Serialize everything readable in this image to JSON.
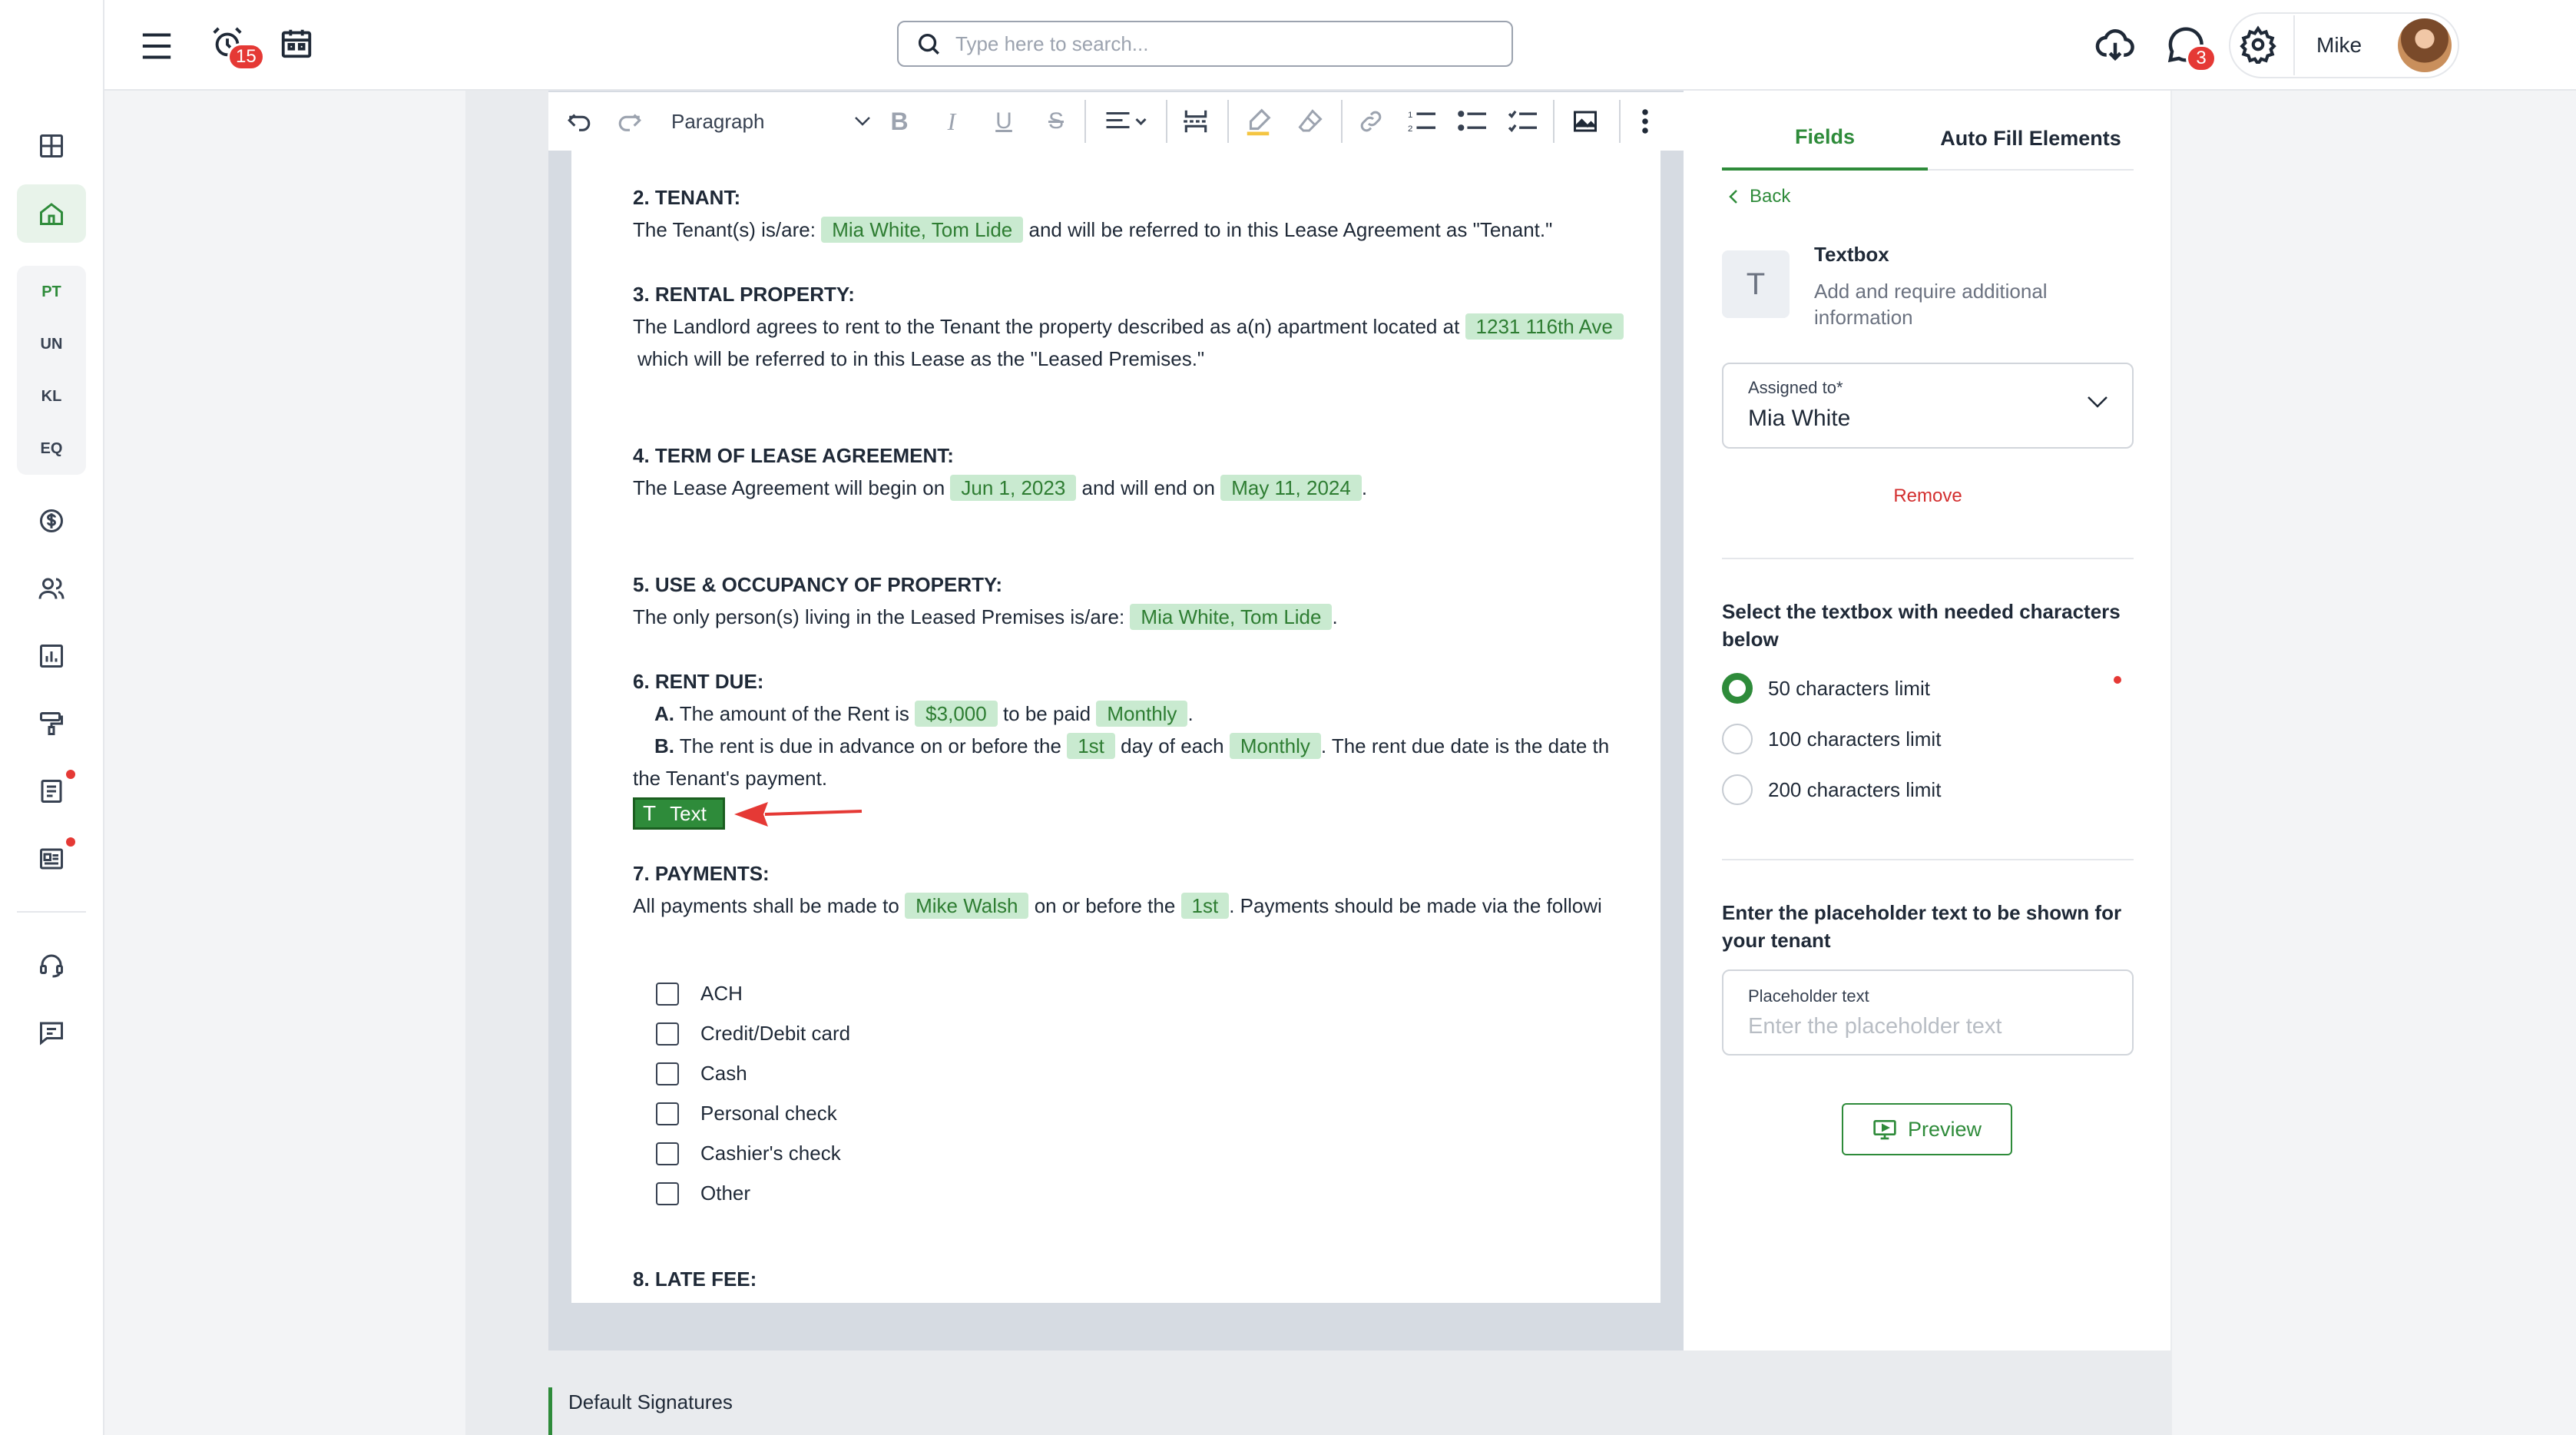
{
  "sidebar": {
    "items": [
      {
        "icon": "dashboard-grid-icon"
      },
      {
        "icon": "home-icon",
        "active": true
      },
      {
        "label": "PT"
      },
      {
        "label": "UN"
      },
      {
        "label": "KL"
      },
      {
        "label": "EQ"
      },
      {
        "icon": "dollar-circle-icon"
      },
      {
        "icon": "people-icon"
      },
      {
        "icon": "bar-chart-icon"
      },
      {
        "icon": "paint-roller-icon"
      },
      {
        "icon": "document-list-icon"
      },
      {
        "icon": "newspaper-icon"
      },
      {
        "icon": "headset-icon"
      },
      {
        "icon": "chat-square-icon"
      }
    ]
  },
  "header": {
    "alarm_badge": "15",
    "search_placeholder": "Type here to search...",
    "messages_badge": "3",
    "user_name": "Mike"
  },
  "toolbar": {
    "paragraph_label": "Paragraph"
  },
  "document": {
    "s2_title": "2. TENANT:",
    "s2_pre": "The Tenant(s) is/are:",
    "s2_tag": "Mia White, Tom Lide",
    "s2_post": "and will be referred to in this Lease Agreement as \"Tenant.\"",
    "s3_title": "3. RENTAL PROPERTY:",
    "s3_pre": "The Landlord agrees to rent to the Tenant the property described as a(n) apartment located at",
    "s3_tag": "1231 116th Ave",
    "s3_line2": "which will be referred to in this Lease as the \"Leased Premises.\"",
    "s4_title": "4. TERM OF LEASE AGREEMENT:",
    "s4_pre": "The Lease Agreement will begin on",
    "s4_tag1": "Jun 1, 2023",
    "s4_mid": "and will end on",
    "s4_tag2": "May 11, 2024",
    "s4_post": ".",
    "s5_title": "5. USE & OCCUPANCY OF PROPERTY:",
    "s5_pre": "The only person(s) living in the Leased Premises is/are:",
    "s5_tag": "Mia White, Tom Lide",
    "s5_post": ".",
    "s6_title": "6. RENT DUE:",
    "s6_a_label": "A.",
    "s6_a_pre": "The amount of the Rent is",
    "s6_a_tag1": "$3,000",
    "s6_a_mid": "to be paid",
    "s6_a_tag2": "Monthly",
    "s6_a_post": ".",
    "s6_b_label": "B.",
    "s6_b_pre": "The rent is due in advance on or before the",
    "s6_b_tag1": "1st",
    "s6_b_mid": "day of each",
    "s6_b_tag2": "Monthly",
    "s6_b_post": ". The rent due date is the date th",
    "s6_line3": "the Tenant's payment.",
    "text_chip_label": "Text",
    "s7_title": "7. PAYMENTS:",
    "s7_pre": "All payments shall be made to",
    "s7_tag1": "Mike Walsh",
    "s7_mid": "on or before the",
    "s7_tag2": "1st",
    "s7_post": ". Payments should be made via the followi",
    "payment_methods": [
      "ACH",
      "Credit/Debit card",
      "Cash",
      "Personal check",
      "Cashier's check",
      "Other"
    ],
    "s8_title": "8. LATE FEE:"
  },
  "panel": {
    "tab_fields": "Fields",
    "tab_autofill": "Auto Fill Elements",
    "back_label": "Back",
    "textbox_icon_letter": "T",
    "textbox_title": "Textbox",
    "textbox_desc": "Add and require additional information",
    "assigned_label": "Assigned to*",
    "assigned_value": "Mia White",
    "remove_label": "Remove",
    "limit_title": "Select the textbox with needed characters below",
    "limits": [
      "50 characters limit",
      "100 characters limit",
      "200 characters limit"
    ],
    "placeholder_title": "Enter the placeholder text to be shown for your tenant",
    "placeholder_label": "Placeholder text",
    "placeholder_input_placeholder": "Enter the placeholder text",
    "preview_label": "Preview"
  },
  "footer": {
    "default_signatures": "Default Signatures"
  },
  "colors": {
    "accent": "#2e8b3a",
    "tag_bg": "#c9ead0",
    "badge": "#e53935",
    "arrow": "#e53935"
  }
}
